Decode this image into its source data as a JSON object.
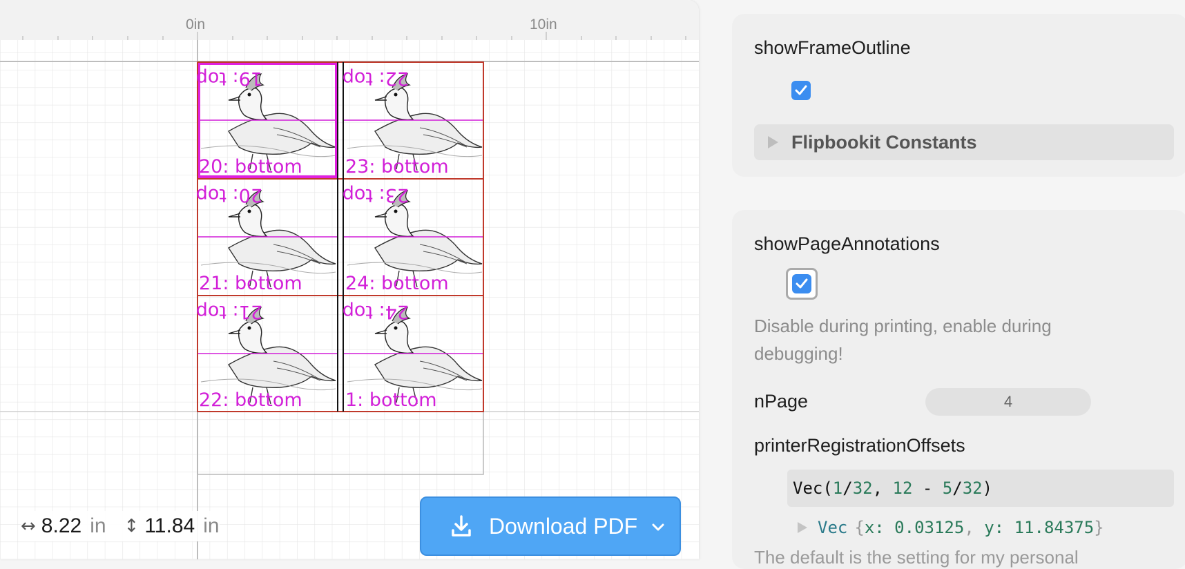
{
  "canvas": {
    "ruler": {
      "labels": [
        "0in",
        "10in"
      ]
    },
    "frames": [
      {
        "top_label": "19: top",
        "bottom_label": "20: bottom"
      },
      {
        "top_label": "22: top",
        "bottom_label": "23: bottom"
      },
      {
        "top_label": "20: top",
        "bottom_label": "21: bottom"
      },
      {
        "top_label": "23: top",
        "bottom_label": "24: bottom"
      },
      {
        "top_label": "21: top",
        "bottom_label": "22: bottom"
      },
      {
        "top_label": "24: top",
        "bottom_label": "1: bottom"
      }
    ],
    "size_readout": {
      "width_value": "8.22",
      "width_unit": "in",
      "height_value": "11.84",
      "height_unit": "in"
    },
    "download_button": {
      "label": "Download PDF"
    }
  },
  "panel": {
    "show_frame_outline": {
      "label": "showFrameOutline",
      "checked": true
    },
    "constants": {
      "label": "Flipbookit Constants"
    },
    "show_page_annotations": {
      "label": "showPageAnnotations",
      "checked": true,
      "description": "Disable during printing, enable during debugging!"
    },
    "n_page": {
      "label": "nPage",
      "value": "4"
    },
    "printer_registration_offsets": {
      "label": "printerRegistrationOffsets",
      "code": {
        "fn": "Vec(",
        "a": "1",
        "s1": "/",
        "b": "32",
        "c": ", ",
        "d": "12",
        "e": " - ",
        "f": "5",
        "s2": "/",
        "g": "32",
        "h": ")"
      },
      "result": {
        "name": "Vec",
        "x_key": "x: ",
        "x_val": "0.03125",
        "y_key": "y: ",
        "y_val": "11.84375"
      },
      "footnote": "The default is the setting for my personal"
    }
  },
  "colors": {
    "accent": "#4fa6f5",
    "annotation": "#d21fd8",
    "frame_outline": "#c0392b"
  }
}
